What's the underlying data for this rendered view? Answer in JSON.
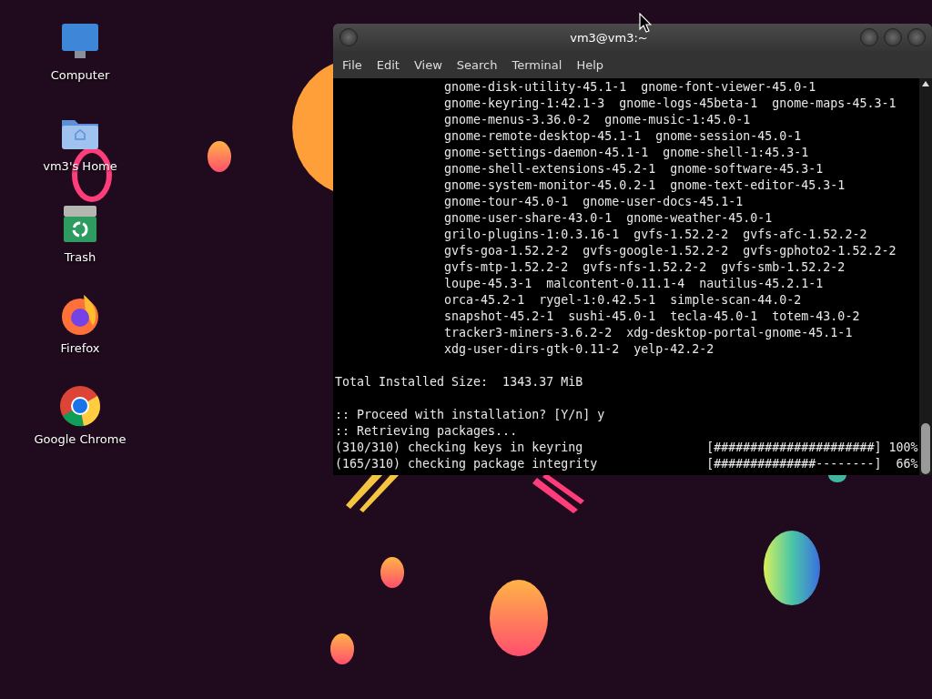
{
  "desktop_icons": [
    {
      "kind": "computer",
      "label": "Computer"
    },
    {
      "kind": "home",
      "label": "vm3's Home"
    },
    {
      "kind": "trash",
      "label": "Trash"
    },
    {
      "kind": "firefox",
      "label": "Firefox"
    },
    {
      "kind": "chrome",
      "label": "Google Chrome"
    }
  ],
  "window": {
    "title": "vm3@vm3:~"
  },
  "menu": [
    "File",
    "Edit",
    "View",
    "Search",
    "Terminal",
    "Help"
  ],
  "terminal_blocks": [
    {
      "lines": [
        "               gnome-disk-utility-45.1-1  gnome-font-viewer-45.0-1",
        "               gnome-keyring-1:42.1-3  gnome-logs-45beta-1  gnome-maps-45.3-1",
        "               gnome-menus-3.36.0-2  gnome-music-1:45.0-1",
        "               gnome-remote-desktop-45.1-1  gnome-session-45.0-1",
        "               gnome-settings-daemon-45.1-1  gnome-shell-1:45.3-1",
        "               gnome-shell-extensions-45.2-1  gnome-software-45.3-1",
        "               gnome-system-monitor-45.0.2-1  gnome-text-editor-45.3-1",
        "               gnome-tour-45.0-1  gnome-user-docs-45.1-1",
        "               gnome-user-share-43.0-1  gnome-weather-45.0-1",
        "               grilo-plugins-1:0.3.16-1  gvfs-1.52.2-2  gvfs-afc-1.52.2-2",
        "               gvfs-goa-1.52.2-2  gvfs-google-1.52.2-2  gvfs-gphoto2-1.52.2-2",
        "               gvfs-mtp-1.52.2-2  gvfs-nfs-1.52.2-2  gvfs-smb-1.52.2-2",
        "               loupe-45.3-1  malcontent-0.11.1-4  nautilus-45.2.1-1",
        "               orca-45.2-1  rygel-1:0.42.5-1  simple-scan-44.0-2",
        "               snapshot-45.2-1  sushi-45.0-1  tecla-45.0-1  totem-43.0-2",
        "               tracker3-miners-3.6.2-2  xdg-desktop-portal-gnome-45.1-1",
        "               xdg-user-dirs-gtk-0.11-2  yelp-42.2-2"
      ]
    },
    {
      "lines": [
        "Total Installed Size:  1343.37 MiB"
      ]
    },
    {
      "lines": [
        ":: Proceed with installation? [Y/n] y",
        ":: Retrieving packages...",
        "(310/310) checking keys in keyring                 [######################] 100%",
        "(165/310) checking package integrity               [##############--------]  66%"
      ]
    }
  ]
}
